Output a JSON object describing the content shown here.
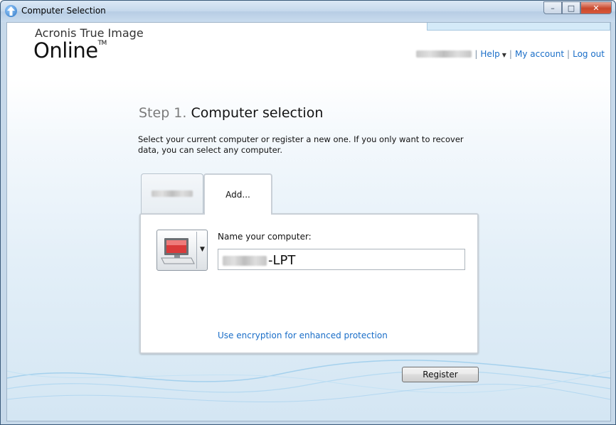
{
  "window": {
    "title": "Computer Selection",
    "controls": {
      "minimize": "–",
      "maximize": "□",
      "close": "✕"
    }
  },
  "brand": {
    "line1": "Acronis True Image",
    "line2": "Online",
    "trademark": "TM"
  },
  "header_links": {
    "user": "",
    "help": "Help",
    "my_account": "My account",
    "log_out": "Log out"
  },
  "step": {
    "number": "Step 1.",
    "title": "Computer selection"
  },
  "description": "Select your current computer or register a new one. If you only want to recover data, you can select any computer.",
  "tabs": [
    {
      "label": ""
    },
    {
      "label": "Add..."
    }
  ],
  "form": {
    "name_label": "Name your computer:",
    "name_suffix": "-LPT",
    "encryption_link": "Use encryption for enhanced protection"
  },
  "buttons": {
    "register": "Register"
  },
  "colors": {
    "link": "#1a6ec8",
    "accent": "#2a74c4"
  }
}
